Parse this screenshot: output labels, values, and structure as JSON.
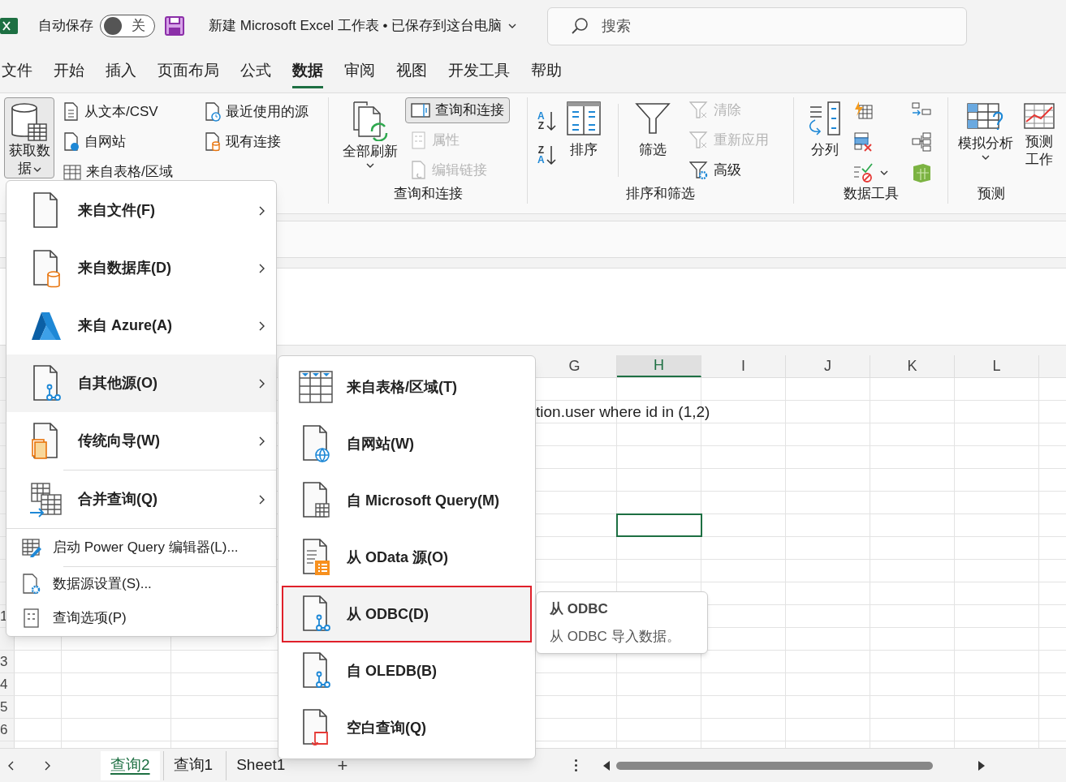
{
  "title_bar": {
    "autosave_label": "自动保存",
    "autosave": {
      "on": false,
      "label": "关"
    },
    "document_title": "新建 Microsoft Excel 工作表 • 已保存到这台电脑",
    "search": {
      "placeholder": "搜索"
    }
  },
  "ribbon_tabs": [
    {
      "label": "文件",
      "selected": false
    },
    {
      "label": "开始",
      "selected": false
    },
    {
      "label": "插入",
      "selected": false
    },
    {
      "label": "页面布局",
      "selected": false
    },
    {
      "label": "公式",
      "selected": false
    },
    {
      "label": "数据",
      "selected": true
    },
    {
      "label": "审阅",
      "selected": false
    },
    {
      "label": "视图",
      "selected": false
    },
    {
      "label": "开发工具",
      "selected": false
    },
    {
      "label": "帮助",
      "selected": false
    }
  ],
  "ribbon": {
    "get_transform": {
      "get_data": {
        "label": "获取数据",
        "expanded": true
      },
      "buttons": [
        {
          "label": "从文本/CSV"
        },
        {
          "label": "自网站"
        },
        {
          "label": "来自表格/区域"
        },
        {
          "label": "最近使用的源"
        },
        {
          "label": "现有连接"
        }
      ]
    },
    "queries": {
      "label": "查询和连接",
      "refresh": "全部刷新",
      "buttons": [
        {
          "label": "查询和连接",
          "selected": true,
          "disabled": false
        },
        {
          "label": "属性",
          "selected": false,
          "disabled": true
        },
        {
          "label": "编辑链接",
          "selected": false,
          "disabled": true
        }
      ]
    },
    "sort_filter": {
      "label": "排序和筛选",
      "sort_ascending": [
        "A",
        "Z"
      ],
      "sort_descending": [
        "Z",
        "A"
      ],
      "sort": "排序",
      "filter": "筛选",
      "buttons": [
        {
          "label": "清除",
          "disabled": true
        },
        {
          "label": "重新应用",
          "disabled": true
        },
        {
          "label": "高级",
          "disabled": false
        }
      ]
    },
    "data_tools": {
      "label": "数据工具",
      "text_to_columns": "分列"
    },
    "forecast": {
      "label": "预测",
      "what_if": "模拟分析",
      "forecast_sheet": "预测工作"
    }
  },
  "sheet": {
    "columns": [
      {
        "label": "G",
        "selected": false
      },
      {
        "label": "H",
        "selected": true
      },
      {
        "label": "I",
        "selected": false
      },
      {
        "label": "J",
        "selected": false
      },
      {
        "label": "K",
        "selected": false
      },
      {
        "label": "L",
        "selected": false
      }
    ],
    "row_labels": [
      "1",
      "3",
      "4",
      "5",
      "6"
    ],
    "cell_text": "tion.user where id in (1,2)"
  },
  "get_data_menu": [
    {
      "label": "来自文件(F)",
      "kind": "submenu",
      "selected": false
    },
    {
      "label": "来自数据库(D)",
      "kind": "submenu",
      "selected": false
    },
    {
      "label": "来自 Azure(A)",
      "kind": "submenu",
      "selected": false
    },
    {
      "label": "自其他源(O)",
      "kind": "submenu",
      "selected": true
    },
    {
      "label": "传统向导(W)",
      "kind": "submenu",
      "selected": false
    },
    {
      "label": "合并查询(Q)",
      "kind": "submenu",
      "selected": false
    },
    {
      "label": "启动 Power Query 编辑器(L)...",
      "kind": "command",
      "selected": false
    },
    {
      "label": "数据源设置(S)...",
      "kind": "command",
      "selected": false
    },
    {
      "label": "查询选项(P)",
      "kind": "command",
      "selected": false
    }
  ],
  "other_sources_menu": [
    {
      "label": "来自表格/区域(T)",
      "selected": false,
      "annotated": false
    },
    {
      "label": "自网站(W)",
      "selected": false,
      "annotated": false
    },
    {
      "label": "自 Microsoft Query(M)",
      "selected": false,
      "annotated": false
    },
    {
      "label": "从 OData 源(O)",
      "selected": false,
      "annotated": false
    },
    {
      "label": "从 ODBC(D)",
      "selected": true,
      "annotated": true
    },
    {
      "label": "自 OLEDB(B)",
      "selected": false,
      "annotated": false
    },
    {
      "label": "空白查询(Q)",
      "selected": false,
      "annotated": false
    }
  ],
  "tooltip": {
    "title": "从 ODBC",
    "description": "从 ODBC 导入数据。"
  },
  "sheet_tabs": [
    {
      "label": "查询2",
      "selected": true
    },
    {
      "label": "查询1",
      "selected": false
    },
    {
      "label": "Sheet1",
      "selected": false
    }
  ],
  "add_sheet": "+"
}
